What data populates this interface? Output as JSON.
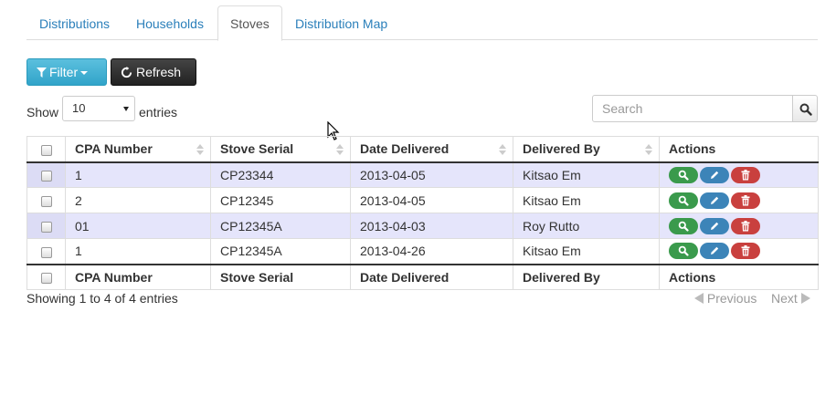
{
  "tabs": [
    {
      "label": "Distributions",
      "active": false
    },
    {
      "label": "Households",
      "active": false
    },
    {
      "label": "Stoves",
      "active": true
    },
    {
      "label": "Distribution Map",
      "active": false
    }
  ],
  "toolbar": {
    "filter_label": "Filter",
    "refresh_label": "Refresh",
    "filter_color": "#31a4c9",
    "refresh_color": "#222222"
  },
  "length": {
    "show_label": "Show",
    "selected": "10",
    "entries_label": "entries"
  },
  "search": {
    "placeholder": "Search",
    "value": ""
  },
  "table": {
    "columns": [
      "CPA Number",
      "Stove Serial",
      "Date Delivered",
      "Delivered By",
      "Actions"
    ],
    "rows": [
      {
        "cpa": "1",
        "serial": "CP23344",
        "date": "2013-04-05",
        "by": "Kitsao Em"
      },
      {
        "cpa": "2",
        "serial": "CP12345",
        "date": "2013-04-05",
        "by": "Kitsao Em"
      },
      {
        "cpa": "01",
        "serial": "CP12345A",
        "date": "2013-04-03",
        "by": "Roy Rutto"
      },
      {
        "cpa": "1",
        "serial": "CP12345A",
        "date": "2013-04-26",
        "by": "Kitsao Em"
      }
    ],
    "action_icons": [
      "search-icon",
      "pencil-icon",
      "trash-icon"
    ],
    "action_colors": {
      "view": "#3a9a4c",
      "edit": "#3c84b8",
      "delete": "#c9403e"
    },
    "odd_row_color": "#e5e5fb"
  },
  "footer": {
    "info": "Showing 1 to 4 of 4 entries",
    "previous_label": "Previous",
    "next_label": "Next"
  }
}
